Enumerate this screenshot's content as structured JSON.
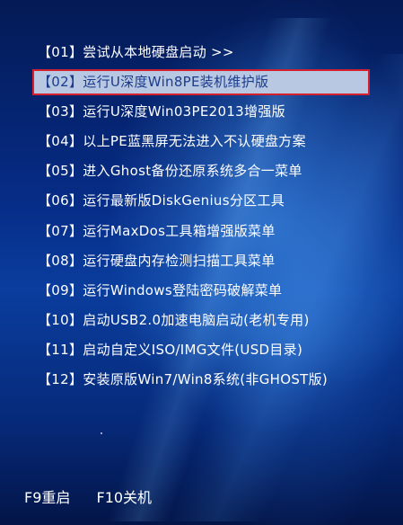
{
  "menu": {
    "selected_index": 1,
    "items": [
      {
        "label": "【01】尝试从本地硬盘启动 >>"
      },
      {
        "label": "【02】运行U深度Win8PE装机维护版"
      },
      {
        "label": "【03】运行U深度Win03PE2013增强版"
      },
      {
        "label": "【04】以上PE蓝黑屏无法进入不认硬盘方案"
      },
      {
        "label": "【05】进入Ghost备份还原系统多合一菜单"
      },
      {
        "label": "【06】运行最新版DiskGenius分区工具"
      },
      {
        "label": "【07】运行MaxDos工具箱增强版菜单"
      },
      {
        "label": "【08】运行硬盘内存检测扫描工具菜单"
      },
      {
        "label": "【09】运行Windows登陆密码破解菜单"
      },
      {
        "label": "【10】启动USB2.0加速电脑启动(老机专用)"
      },
      {
        "label": "【11】启动自定义ISO/IMG文件(USD目录)"
      },
      {
        "label": "【12】安装原版Win7/Win8系统(非GHOST版)"
      }
    ]
  },
  "footer": {
    "f9_label": "F9重启",
    "f10_label": "F10关机"
  },
  "colors": {
    "background": "#062c86",
    "selected_background": "#b8c7e2",
    "selected_border": "#d4202c",
    "selected_text": "#1a3c8c",
    "text": "#ffffff"
  }
}
